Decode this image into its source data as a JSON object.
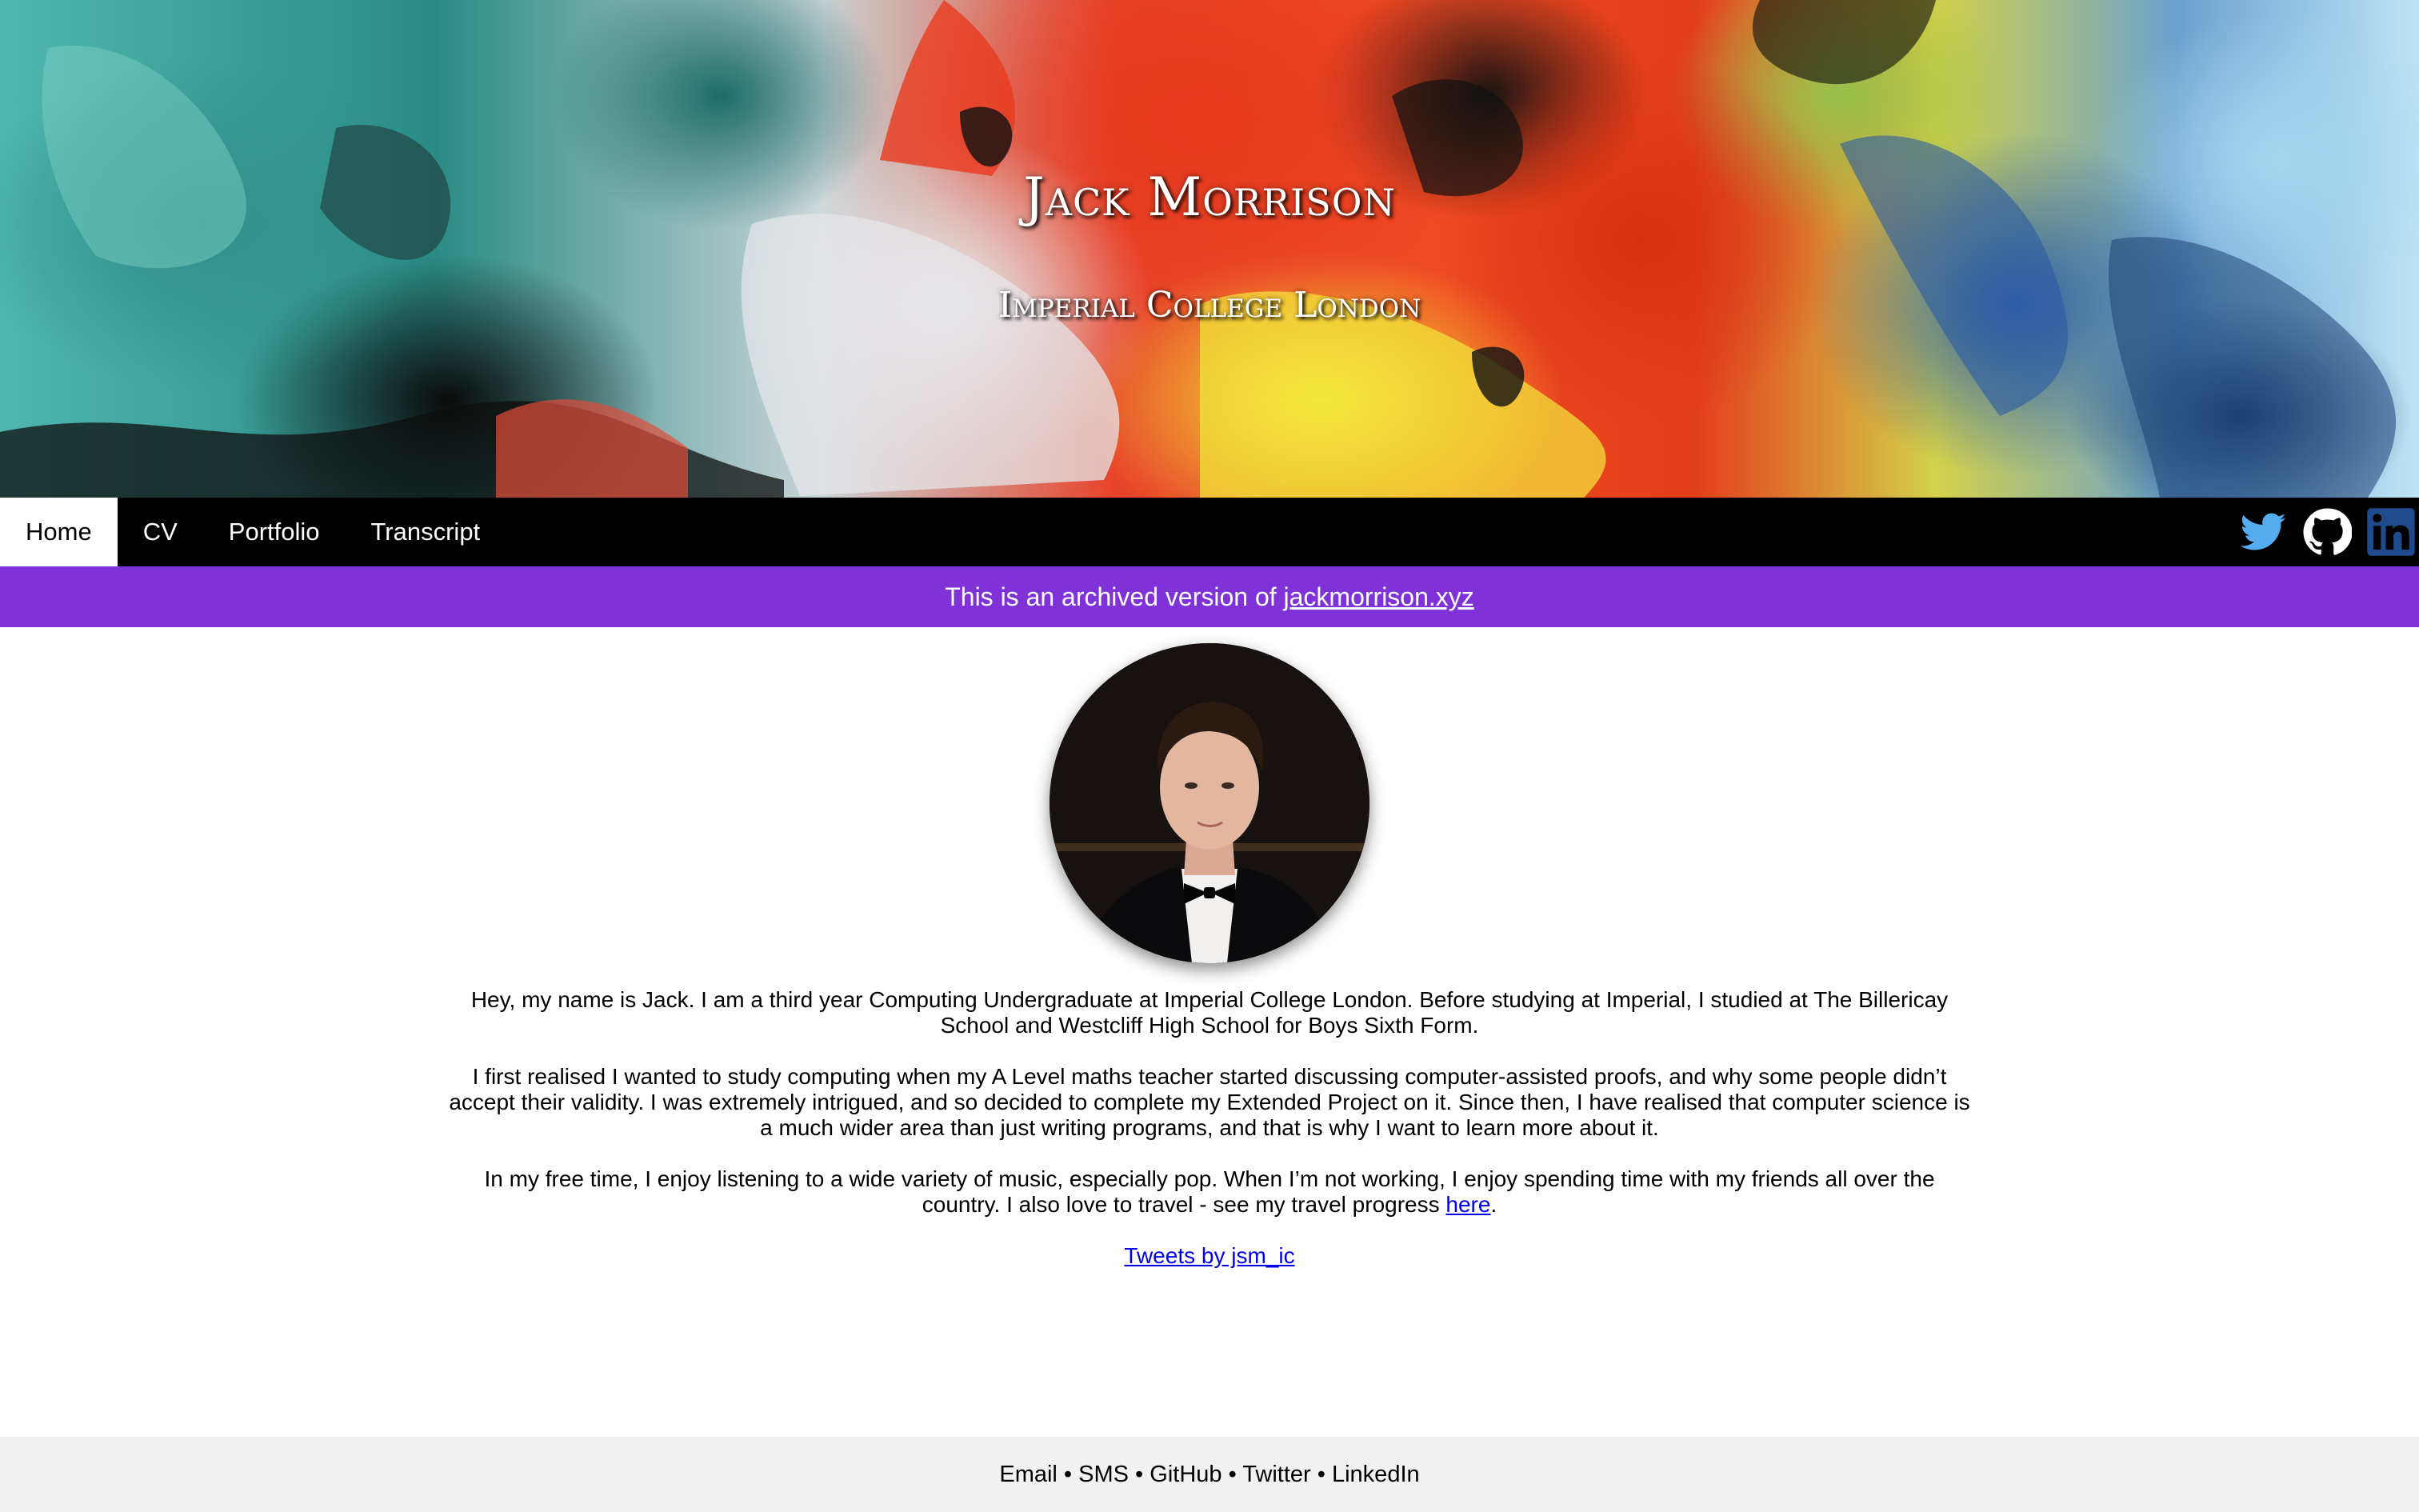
{
  "header": {
    "title": "Jack Morrison",
    "subtitle": "Imperial College London"
  },
  "nav": {
    "items": [
      {
        "label": "Home",
        "active": true
      },
      {
        "label": "CV",
        "active": false
      },
      {
        "label": "Portfolio",
        "active": false
      },
      {
        "label": "Transcript",
        "active": false
      }
    ],
    "social": [
      {
        "icon": "twitter-icon",
        "color": "#55acee"
      },
      {
        "icon": "github-icon",
        "color": "#ffffff"
      },
      {
        "icon": "linkedin-icon",
        "color": "#1f4a8c"
      }
    ]
  },
  "notice": {
    "text": "This is an archived version of ",
    "link": "jackmorrison.xyz",
    "color": "#8032d9"
  },
  "main": {
    "paragraphs": [
      "Hey, my name is Jack. I am a third year Computing Undergraduate at Imperial College London. Before studying at Imperial, I studied at The Billericay School and Westcliff High School for Boys Sixth Form.",
      "I first realised I wanted to study computing when my A Level maths teacher started discussing computer-assisted proofs, and why some people didn’t accept their validity. I was extremely intrigued, and so decided to complete my Extended Project on it. Since then, I have realised that computer science is a much wider area than just writing programs, and that is why I want to learn more about it."
    ],
    "paragraph3_prefix": "In my free time, I enjoy listening to a wide variety of music, especially pop. When I’m not working, I enjoy spending time with my friends all over the country. I also love to travel - see my travel progress ",
    "paragraph3_link": "here",
    "paragraph3_suffix": ".",
    "tweets_link": "Tweets by jsm_ic"
  },
  "footer": {
    "links": [
      "Email",
      "SMS",
      "GitHub",
      "Twitter",
      "LinkedIn"
    ],
    "separator": " • "
  }
}
